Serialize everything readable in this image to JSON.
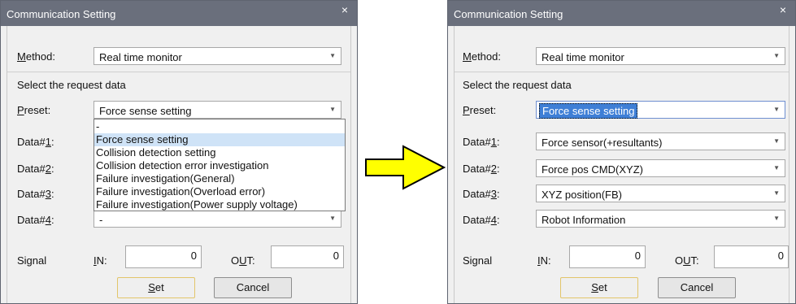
{
  "left": {
    "title": "Communication Setting",
    "close": "×",
    "method": {
      "label_pre": "",
      "label_u": "M",
      "label_post": "ethod:",
      "value": "Real time monitor"
    },
    "section": "Select the request data",
    "preset": {
      "label_u": "P",
      "label_post": "reset:",
      "value": "Force sense setting"
    },
    "data_rows": [
      {
        "pre": "Data#",
        "u": "1",
        "post": ":",
        "value": ""
      },
      {
        "pre": "Data#",
        "u": "2",
        "post": ":",
        "value": ""
      },
      {
        "pre": "Data#",
        "u": "3",
        "post": ":",
        "value": ""
      },
      {
        "pre": "Data#",
        "u": "4",
        "post": ":",
        "value": "-"
      }
    ],
    "dropdown_options": [
      "-",
      "Force sense setting",
      "Collision detection setting",
      "Collision detection error investigation",
      "Failure investigation(General)",
      "Failure investigation(Overload error)",
      "Failure investigation(Power supply voltage)"
    ],
    "signal": {
      "label": "Signal",
      "in_u": "I",
      "in_post": "N:",
      "in_value": "0",
      "out_pre": "O",
      "out_u": "U",
      "out_post": "T:",
      "out_value": "0"
    },
    "set_u": "S",
    "set_post": "et",
    "cancel": "Cancel"
  },
  "right": {
    "title": "Communication Setting",
    "close": "×",
    "method": {
      "label_u": "M",
      "label_post": "ethod:",
      "value": "Real time monitor"
    },
    "section": "Select the request data",
    "preset": {
      "label_u": "P",
      "label_post": "reset:",
      "value": "Force sense setting"
    },
    "data_rows": [
      {
        "pre": "Data#",
        "u": "1",
        "post": ":",
        "value": "Force sensor(+resultants)"
      },
      {
        "pre": "Data#",
        "u": "2",
        "post": ":",
        "value": "Force pos CMD(XYZ)"
      },
      {
        "pre": "Data#",
        "u": "3",
        "post": ":",
        "value": "XYZ position(FB)"
      },
      {
        "pre": "Data#",
        "u": "4",
        "post": ":",
        "value": "Robot Information"
      }
    ],
    "signal": {
      "label": "Signal",
      "in_u": "I",
      "in_post": "N:",
      "in_value": "0",
      "out_pre": "O",
      "out_u": "U",
      "out_post": "T:",
      "out_value": "0"
    },
    "set_u": "S",
    "set_post": "et",
    "cancel": "Cancel"
  },
  "colors": {
    "titlebar": "#6a6f7c",
    "arrow_fill": "#ffff00",
    "selection": "#3f7fd6",
    "hover": "#cfe3f7"
  },
  "icons": {
    "dropdown": "chevron-down-icon",
    "close": "close-icon",
    "transition": "right-arrow-icon"
  }
}
